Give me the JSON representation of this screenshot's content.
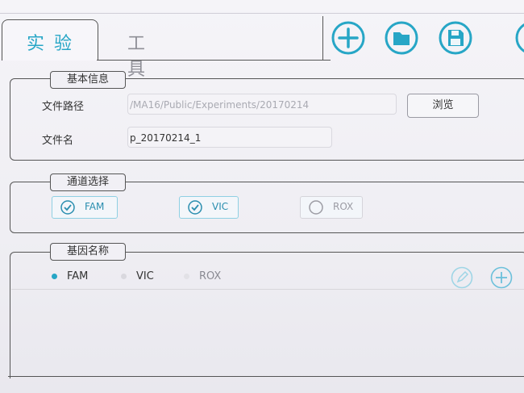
{
  "tabs": {
    "experiment": "实验",
    "tools": "工具"
  },
  "toolbar": {
    "new_icon": "plus-circle-icon",
    "open_icon": "folder-icon",
    "save_icon": "save-icon",
    "accent": "#27a6c6"
  },
  "basic_info": {
    "title": "基本信息",
    "path_label": "文件路径",
    "path_value": "/MA16/Public/Experiments/20170214",
    "browse_label": "浏览",
    "name_label": "文件名",
    "name_value": "p_20170214_1"
  },
  "channels": {
    "title": "通道选择",
    "items": [
      {
        "label": "FAM",
        "checked": true
      },
      {
        "label": "VIC",
        "checked": true
      },
      {
        "label": "ROX",
        "checked": false
      }
    ]
  },
  "genes": {
    "title": "基因名称",
    "radios": [
      {
        "label": "FAM",
        "selected": true
      },
      {
        "label": "VIC",
        "selected": false
      },
      {
        "label": "ROX",
        "selected": false
      }
    ],
    "edit_icon": "edit-icon",
    "add_icon": "plus-circle-icon"
  }
}
